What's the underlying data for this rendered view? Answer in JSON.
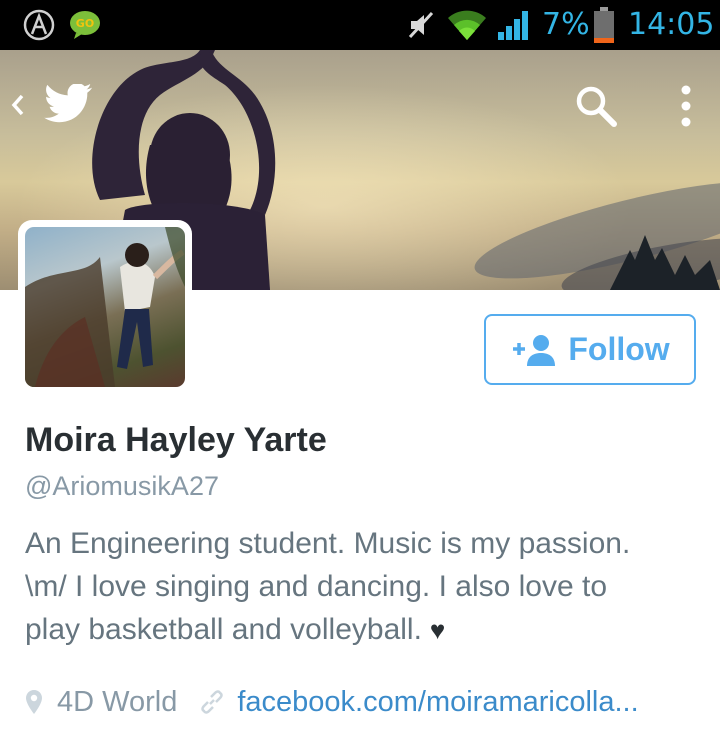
{
  "status_bar": {
    "battery_percent": "7%",
    "time": "14:05",
    "accent_color": "#33b5e5",
    "icons": [
      "app-a-icon",
      "go-sms-icon",
      "muted-volume-icon",
      "wifi-icon",
      "cell-signal-icon",
      "battery-icon"
    ]
  },
  "header": {
    "icons": [
      "back-chevron-icon",
      "twitter-bird-icon",
      "search-icon",
      "overflow-menu-icon"
    ]
  },
  "profile": {
    "name": "Moira Hayley Yarte",
    "handle": "@AriomusikA27",
    "bio_lines": [
      "An Engineering student. Music is my passion.",
      "\\m/ I love singing and dancing. I also love to",
      "play basketball and volleyball."
    ],
    "bio_emoji": "♥",
    "location": "4D World",
    "url": "facebook.com/moiramaricolla..."
  },
  "follow_button": {
    "label": "Follow",
    "color": "#55acee"
  }
}
